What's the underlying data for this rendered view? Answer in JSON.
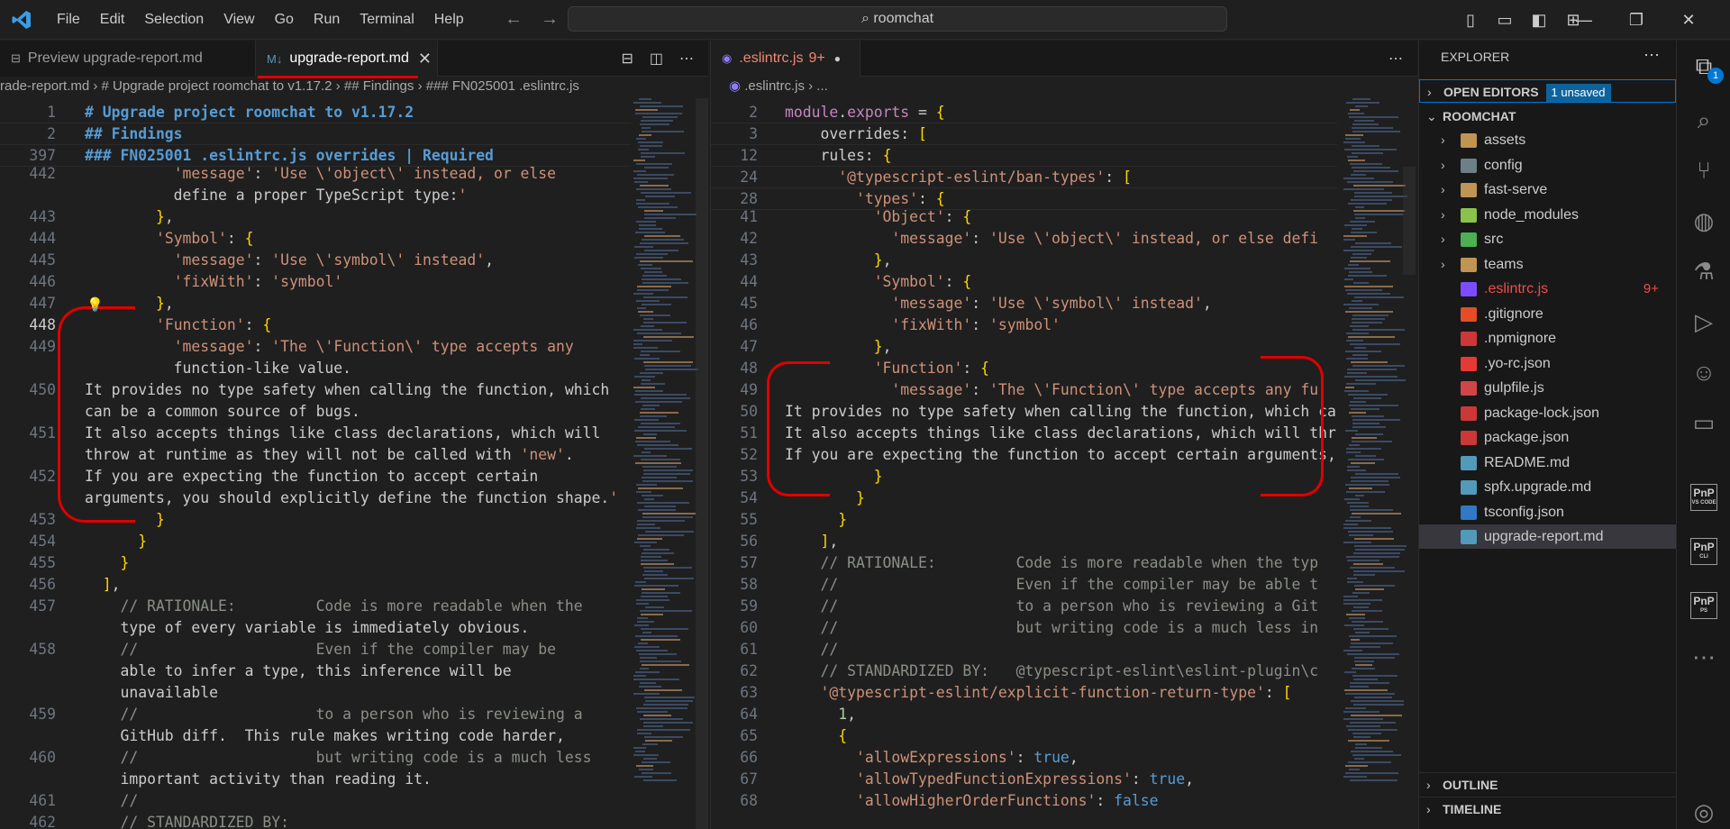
{
  "titlebar": {
    "menu": [
      "File",
      "Edit",
      "Selection",
      "View",
      "Go",
      "Run",
      "Terminal",
      "Help"
    ],
    "search": "roomchat"
  },
  "left_editor": {
    "tabs": [
      {
        "label": "Preview upgrade-report.md",
        "icon": "preview-icon"
      },
      {
        "label": "upgrade-report.md",
        "icon": "M↓",
        "close": "✕"
      }
    ],
    "breadcrumb": "rade-report.md  ›  # Upgrade project roomchat to v1.17.2  ›  ## Findings  ›  ### FN025001 .eslintrc.js",
    "sticky": [
      {
        "n": "1",
        "t": "# Upgrade project roomchat to v1.17.2"
      },
      {
        "n": "2",
        "t": "## Findings"
      },
      {
        "n": "397",
        "t": "### FN025001 .eslintrc.js overrides | Required"
      }
    ],
    "lines": [
      {
        "n": "442",
        "t": "          'message': 'Use \\'object\\' instead, or else"
      },
      {
        "n": "",
        "t": "          define a proper TypeScript type:'"
      },
      {
        "n": "443",
        "t": "        },"
      },
      {
        "n": "444",
        "t": "        'Symbol': {"
      },
      {
        "n": "445",
        "t": "          'message': 'Use \\'symbol\\' instead',"
      },
      {
        "n": "446",
        "t": "          'fixWith': 'symbol'"
      },
      {
        "n": "447",
        "t": "        },"
      },
      {
        "n": "448",
        "t": "        'Function': {"
      },
      {
        "n": "449",
        "t": "          'message': 'The \\'Function\\' type accepts any"
      },
      {
        "n": "",
        "t": "          function-like value."
      },
      {
        "n": "450",
        "t": "It provides no type safety when calling the function, which"
      },
      {
        "n": "",
        "t": "can be a common source of bugs."
      },
      {
        "n": "451",
        "t": "It also accepts things like class declarations, which will"
      },
      {
        "n": "",
        "t": "throw at runtime as they will not be called with 'new'."
      },
      {
        "n": "452",
        "t": "If you are expecting the function to accept certain"
      },
      {
        "n": "",
        "t": "arguments, you should explicitly define the function shape.'"
      },
      {
        "n": "453",
        "t": "        }"
      },
      {
        "n": "454",
        "t": "      }"
      },
      {
        "n": "455",
        "t": "    }"
      },
      {
        "n": "456",
        "t": "  ],"
      },
      {
        "n": "457",
        "t": "    // RATIONALE:         Code is more readable when the"
      },
      {
        "n": "",
        "t": "    type of every variable is immediately obvious."
      },
      {
        "n": "458",
        "t": "    //                    Even if the compiler may be"
      },
      {
        "n": "",
        "t": "    able to infer a type, this inference will be"
      },
      {
        "n": "",
        "t": "    unavailable"
      },
      {
        "n": "459",
        "t": "    //                    to a person who is reviewing a"
      },
      {
        "n": "",
        "t": "    GitHub diff.  This rule makes writing code harder,"
      },
      {
        "n": "460",
        "t": "    //                    but writing code is a much less"
      },
      {
        "n": "",
        "t": "    important activity than reading it."
      },
      {
        "n": "461",
        "t": "    //"
      },
      {
        "n": "462",
        "t": "    // STANDARDIZED BY:"
      }
    ]
  },
  "right_editor": {
    "tab": {
      "label": ".eslintrc.js",
      "count": "9+",
      "icon": "eslint-icon"
    },
    "breadcrumb": ".eslintrc.js  ›  ...",
    "sticky": [
      {
        "n": "2",
        "t": "module.exports = {"
      },
      {
        "n": "3",
        "t": "    overrides: ["
      },
      {
        "n": "12",
        "t": "    rules: {"
      },
      {
        "n": "24",
        "t": "      '@typescript-eslint/ban-types': ["
      },
      {
        "n": "28",
        "t": "        'types': {"
      }
    ],
    "lines": [
      {
        "n": "41",
        "t": "          'Object': {"
      },
      {
        "n": "42",
        "t": "            'message': 'Use \\'object\\' instead, or else defi"
      },
      {
        "n": "43",
        "t": "          },"
      },
      {
        "n": "44",
        "t": "          'Symbol': {"
      },
      {
        "n": "45",
        "t": "            'message': 'Use \\'symbol\\' instead',"
      },
      {
        "n": "46",
        "t": "            'fixWith': 'symbol'"
      },
      {
        "n": "47",
        "t": "          },"
      },
      {
        "n": "48",
        "t": "          'Function': {"
      },
      {
        "n": "49",
        "t": "            'message': 'The \\'Function\\' type accepts any fu"
      },
      {
        "n": "50",
        "t": "It provides no type safety when calling the function, which can"
      },
      {
        "n": "51",
        "t": "It also accepts things like class declarations, which will throw"
      },
      {
        "n": "52",
        "t": "If you are expecting the function to accept certain arguments, y"
      },
      {
        "n": "53",
        "t": "          }"
      },
      {
        "n": "54",
        "t": "        }"
      },
      {
        "n": "55",
        "t": "      }"
      },
      {
        "n": "56",
        "t": "    ],"
      },
      {
        "n": "57",
        "t": "    // RATIONALE:         Code is more readable when the typ"
      },
      {
        "n": "58",
        "t": "    //                    Even if the compiler may be able t"
      },
      {
        "n": "59",
        "t": "    //                    to a person who is reviewing a Git"
      },
      {
        "n": "60",
        "t": "    //                    but writing code is a much less in"
      },
      {
        "n": "61",
        "t": "    //"
      },
      {
        "n": "62",
        "t": "    // STANDARDIZED BY:   @typescript-eslint\\eslint-plugin\\c"
      },
      {
        "n": "63",
        "t": "    '@typescript-eslint/explicit-function-return-type': ["
      },
      {
        "n": "64",
        "t": "      1,"
      },
      {
        "n": "65",
        "t": "      {"
      },
      {
        "n": "66",
        "t": "        'allowExpressions': true,"
      },
      {
        "n": "67",
        "t": "        'allowTypedFunctionExpressions': true,"
      },
      {
        "n": "68",
        "t": "        'allowHigherOrderFunctions': false"
      }
    ]
  },
  "explorer": {
    "title": "EXPLORER",
    "open_editors": "OPEN EDITORS",
    "unsaved": "1 unsaved",
    "root": "ROOMCHAT",
    "items": [
      {
        "name": "assets",
        "kind": "folder",
        "icon_color": "#c09553"
      },
      {
        "name": "config",
        "kind": "folder",
        "icon_color": "#6d8086"
      },
      {
        "name": "fast-serve",
        "kind": "folder",
        "icon_color": "#c09553"
      },
      {
        "name": "node_modules",
        "kind": "folder",
        "icon_color": "#8bc34a"
      },
      {
        "name": "src",
        "kind": "folder",
        "icon_color": "#4caf50"
      },
      {
        "name": "teams",
        "kind": "folder",
        "icon_color": "#c09553"
      },
      {
        "name": ".eslintrc.js",
        "kind": "file",
        "icon_color": "#7c4dff",
        "count": "9+",
        "error": true
      },
      {
        "name": ".gitignore",
        "kind": "file",
        "icon_color": "#e44d26"
      },
      {
        "name": ".npmignore",
        "kind": "file",
        "icon_color": "#cb3837"
      },
      {
        "name": ".yo-rc.json",
        "kind": "file",
        "icon_color": "#e53935"
      },
      {
        "name": "gulpfile.js",
        "kind": "file",
        "icon_color": "#cf4647"
      },
      {
        "name": "package-lock.json",
        "kind": "file",
        "icon_color": "#cb3837"
      },
      {
        "name": "package.json",
        "kind": "file",
        "icon_color": "#cb3837"
      },
      {
        "name": "README.md",
        "kind": "file",
        "icon_color": "#519aba"
      },
      {
        "name": "spfx.upgrade.md",
        "kind": "file",
        "icon_color": "#519aba"
      },
      {
        "name": "tsconfig.json",
        "kind": "file",
        "icon_color": "#3178c6"
      },
      {
        "name": "upgrade-report.md",
        "kind": "file",
        "icon_color": "#519aba",
        "selected": true
      }
    ],
    "outline": "OUTLINE",
    "timeline": "TIMELINE"
  },
  "activity": {
    "explorer_badge": "1",
    "pnp": [
      {
        "top": "PnP",
        "sub": "VS CODE"
      },
      {
        "top": "PnP",
        "sub": "CLI"
      },
      {
        "top": "PnP",
        "sub": "PS"
      }
    ]
  },
  "colors": {
    "accent": "#0078d4",
    "error": "#f14c4c",
    "annotation": "#e00000"
  }
}
